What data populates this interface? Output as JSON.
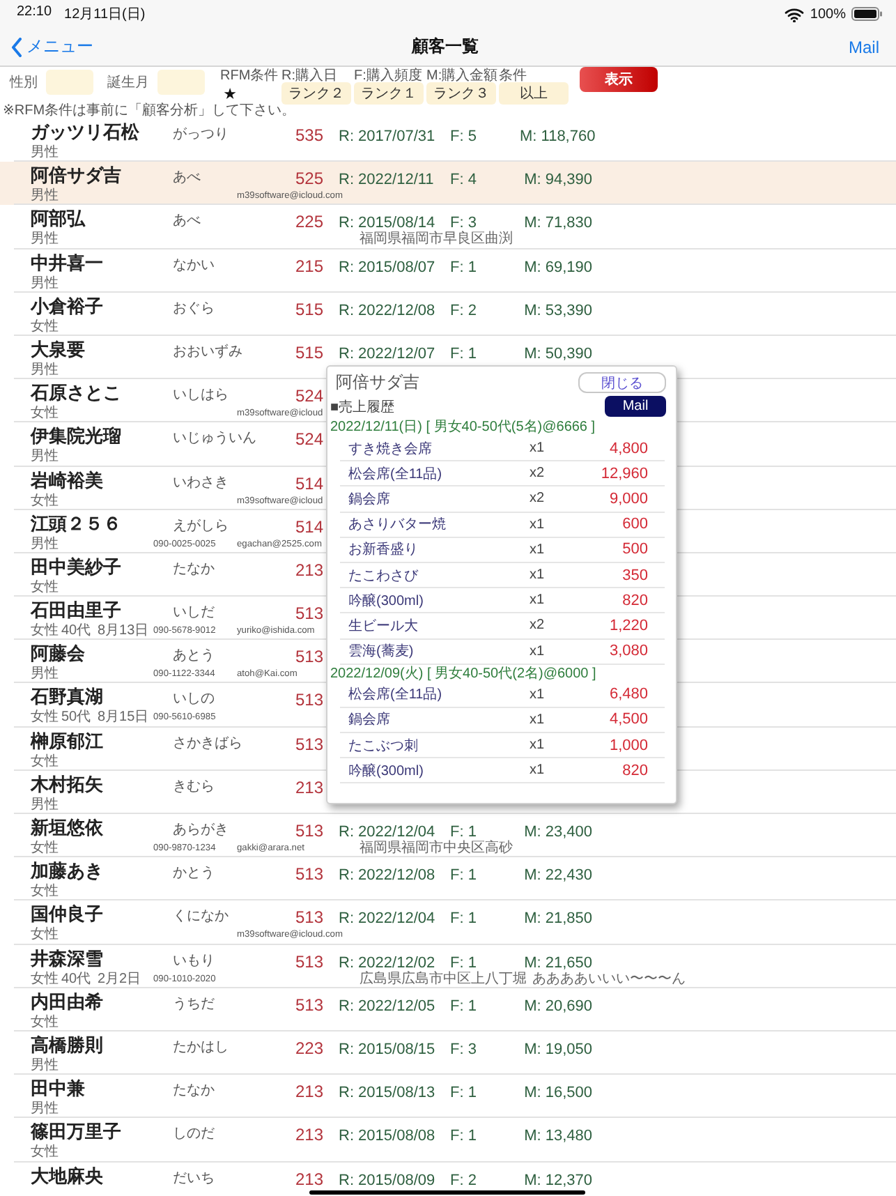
{
  "status_bar": {
    "time": "22:10",
    "date": "12月11日(日)",
    "battery": "100%"
  },
  "nav": {
    "back": "メニュー",
    "title": "顧客一覧",
    "action": "Mail"
  },
  "filters": {
    "fields": [
      {
        "label": "性別"
      },
      {
        "label": "誕生月"
      }
    ],
    "rfm_label": "RFM条件",
    "star": "★",
    "conditions": [
      {
        "label": "R:購入日",
        "value": "ランク２"
      },
      {
        "label": "F:購入頻度",
        "value": "ランク１"
      },
      {
        "label": "M:購入金額",
        "value": "ランク３"
      },
      {
        "label": "条件",
        "value": "以上"
      }
    ],
    "show_button": "表示",
    "note": "※RFM条件は事前に「顧客分析」して下さい。"
  },
  "customers": [
    {
      "name": "ガッツリ石松",
      "kana": "がっつり",
      "score": "535",
      "recency": "R: 2017/07/31",
      "frequency": "F: 5",
      "monetary": "M: 118,760",
      "gender": "男性",
      "selected": false
    },
    {
      "name": "阿倍サダ吉",
      "kana": "あべ",
      "score": "525",
      "recency": "R: 2022/12/11",
      "frequency": "F: 4",
      "monetary": "M: 94,390",
      "gender": "男性",
      "email": "m39software@icloud.com",
      "selected": true
    },
    {
      "name": "阿部弘",
      "kana": "あべ",
      "score": "225",
      "recency": "R: 2015/08/14",
      "frequency": "F: 3",
      "monetary": "M: 71,830",
      "gender": "男性",
      "address": "福岡県福岡市早良区曲渕",
      "selected": false
    },
    {
      "name": "中井喜一",
      "kana": "なかい",
      "score": "215",
      "recency": "R: 2015/08/07",
      "frequency": "F: 1",
      "monetary": "M: 69,190",
      "gender": "男性",
      "selected": false
    },
    {
      "name": "小倉裕子",
      "kana": "おぐら",
      "score": "515",
      "recency": "R: 2022/12/08",
      "frequency": "F: 2",
      "monetary": "M: 53,390",
      "gender": "女性",
      "selected": false
    },
    {
      "name": "大泉要",
      "kana": "おおいずみ",
      "score": "515",
      "recency": "R: 2022/12/07",
      "frequency": "F: 1",
      "monetary": "M: 50,390",
      "gender": "男性",
      "selected": false
    },
    {
      "name": "石原さとこ",
      "kana": "いしはら",
      "score": "524",
      "gender": "女性",
      "email": "m39software@icloud",
      "selected": false
    },
    {
      "name": "伊集院光瑠",
      "kana": "いじゅういん",
      "score": "524",
      "gender": "男性",
      "selected": false
    },
    {
      "name": "岩崎裕美",
      "kana": "いわさき",
      "score": "514",
      "gender": "女性",
      "email": "m39software@icloud",
      "selected": false
    },
    {
      "name": "江頭２５６",
      "kana": "えがしら",
      "score": "514",
      "gender": "男性",
      "phone": "090-0025-0025",
      "email": "egachan@2525.com",
      "selected": false
    },
    {
      "name": "田中美紗子",
      "kana": "たなか",
      "score": "213",
      "gender": "女性",
      "selected": false
    },
    {
      "name": "石田由里子",
      "kana": "いしだ",
      "score": "513",
      "gender": "女性",
      "age": "40代",
      "birthday": "8月13日",
      "phone": "090-5678-9012",
      "email": "yuriko@ishida.com",
      "selected": false
    },
    {
      "name": "阿藤会",
      "kana": "あとう",
      "score": "513",
      "gender": "男性",
      "phone": "090-1122-3344",
      "email": "atoh@Kai.com",
      "selected": false
    },
    {
      "name": "石野真湖",
      "kana": "いしの",
      "score": "513",
      "gender": "女性",
      "age": "50代",
      "birthday": "8月15日",
      "phone": "090-5610-6985",
      "selected": false
    },
    {
      "name": "榊原郁江",
      "kana": "さかきばら",
      "score": "513",
      "gender": "女性",
      "selected": false
    },
    {
      "name": "木村拓矢",
      "kana": "きむら",
      "score": "213",
      "gender": "男性",
      "selected": false
    },
    {
      "name": "新垣悠依",
      "kana": "あらがき",
      "score": "513",
      "recency": "R: 2022/12/04",
      "frequency": "F: 1",
      "monetary": "M: 23,400",
      "gender": "女性",
      "phone": "090-9870-1234",
      "email": "gakki@arara.net",
      "address": "福岡県福岡市中央区高砂",
      "selected": false
    },
    {
      "name": "加藤あき",
      "kana": "かとう",
      "score": "513",
      "recency": "R: 2022/12/08",
      "frequency": "F: 1",
      "monetary": "M: 22,430",
      "gender": "女性",
      "selected": false
    },
    {
      "name": "国仲良子",
      "kana": "くになか",
      "score": "513",
      "recency": "R: 2022/12/04",
      "frequency": "F: 1",
      "monetary": "M: 21,850",
      "gender": "女性",
      "email": "m39software@icloud.com",
      "selected": false
    },
    {
      "name": "井森深雪",
      "kana": "いもり",
      "score": "513",
      "recency": "R: 2022/12/02",
      "frequency": "F: 1",
      "monetary": "M: 21,650",
      "gender": "女性",
      "age": "40代",
      "birthday": "2月2日",
      "phone": "090-1010-2020",
      "address": "広島県広島市中区上八丁堀",
      "memo": "ああああいいい〜〜〜ん",
      "selected": false
    },
    {
      "name": "内田由希",
      "kana": "うちだ",
      "score": "513",
      "recency": "R: 2022/12/05",
      "frequency": "F: 1",
      "monetary": "M: 20,690",
      "gender": "女性",
      "selected": false
    },
    {
      "name": "高橋勝則",
      "kana": "たかはし",
      "score": "223",
      "recency": "R: 2015/08/15",
      "frequency": "F: 3",
      "monetary": "M: 19,050",
      "gender": "男性",
      "selected": false
    },
    {
      "name": "田中兼",
      "kana": "たなか",
      "score": "213",
      "recency": "R: 2015/08/13",
      "frequency": "F: 1",
      "monetary": "M: 16,500",
      "gender": "男性",
      "selected": false
    },
    {
      "name": "篠田万里子",
      "kana": "しのだ",
      "score": "213",
      "recency": "R: 2015/08/08",
      "frequency": "F: 1",
      "monetary": "M: 13,480",
      "gender": "女性",
      "selected": false
    },
    {
      "name": "大地麻央",
      "kana": "だいち",
      "score": "213",
      "recency": "R: 2015/08/09",
      "frequency": "F: 2",
      "monetary": "M: 12,370",
      "selected": false
    }
  ],
  "popup": {
    "title": "阿倍サダ吉",
    "close": "閉じる",
    "section": "■売上履歴",
    "mail": "Mail",
    "orders": [
      {
        "header": "2022/12/11(日) [ 男女40-50代(5名)@6666 ]",
        "items": [
          {
            "name": "すき焼き会席",
            "qty": "x1",
            "price": "4,800"
          },
          {
            "name": "松会席(全11品)",
            "qty": "x2",
            "price": "12,960"
          },
          {
            "name": "鍋会席",
            "qty": "x2",
            "price": "9,000"
          },
          {
            "name": "あさりバター焼",
            "qty": "x1",
            "price": "600"
          },
          {
            "name": "お新香盛り",
            "qty": "x1",
            "price": "500"
          },
          {
            "name": "たこわさび",
            "qty": "x1",
            "price": "350"
          },
          {
            "name": "吟醸(300ml)",
            "qty": "x1",
            "price": "820"
          },
          {
            "name": "生ビール大",
            "qty": "x2",
            "price": "1,220"
          },
          {
            "name": "雲海(蕎麦)",
            "qty": "x1",
            "price": "3,080"
          }
        ]
      },
      {
        "header": "2022/12/09(火) [ 男女40-50代(2名)@6000 ]",
        "items": [
          {
            "name": "松会席(全11品)",
            "qty": "x1",
            "price": "6,480"
          },
          {
            "name": "鍋会席",
            "qty": "x1",
            "price": "4,500"
          },
          {
            "name": "たこぶつ刺",
            "qty": "x1",
            "price": "1,000"
          },
          {
            "name": "吟醸(300ml)",
            "qty": "x1",
            "price": "820"
          }
        ]
      }
    ]
  }
}
